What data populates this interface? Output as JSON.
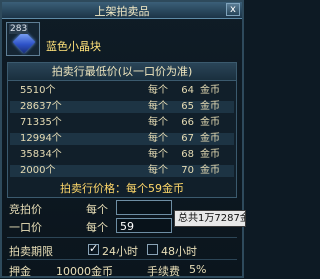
{
  "window": {
    "title": "上架拍卖品",
    "close_label": "x"
  },
  "item": {
    "name": "蓝色小晶块",
    "stack_count": "283",
    "icon": "blue-crystal-icon"
  },
  "price_panel": {
    "header": "拍卖行最低价(以一口价为准)",
    "rows": [
      {
        "qty": "5510个",
        "each": "每个",
        "price": "64",
        "currency": "金币"
      },
      {
        "qty": "28637个",
        "each": "每个",
        "price": "65",
        "currency": "金币"
      },
      {
        "qty": "71335个",
        "each": "每个",
        "price": "66",
        "currency": "金币"
      },
      {
        "qty": "12994个",
        "each": "每个",
        "price": "67",
        "currency": "金币"
      },
      {
        "qty": "35834个",
        "each": "每个",
        "price": "68",
        "currency": "金币"
      },
      {
        "qty": "2000个",
        "each": "每个",
        "price": "70",
        "currency": "金币"
      }
    ],
    "summary": "拍卖行价格：每个59金币"
  },
  "form": {
    "bid_label": "竞拍价",
    "bid_each": "每个",
    "bid_value": "",
    "buyout_label": "一口价",
    "buyout_each": "每个",
    "buyout_value": "59",
    "tooltip": "总共1万7287金",
    "duration_label": "拍卖期限",
    "opt_24": "24小时",
    "opt_48": "48小时",
    "deposit_label": "押金",
    "deposit_value": "10000金币",
    "fee_label": "手续费",
    "fee_value": "5%"
  },
  "colors": {
    "accent": "#ffd86a",
    "item_name": "#ffe27a"
  }
}
